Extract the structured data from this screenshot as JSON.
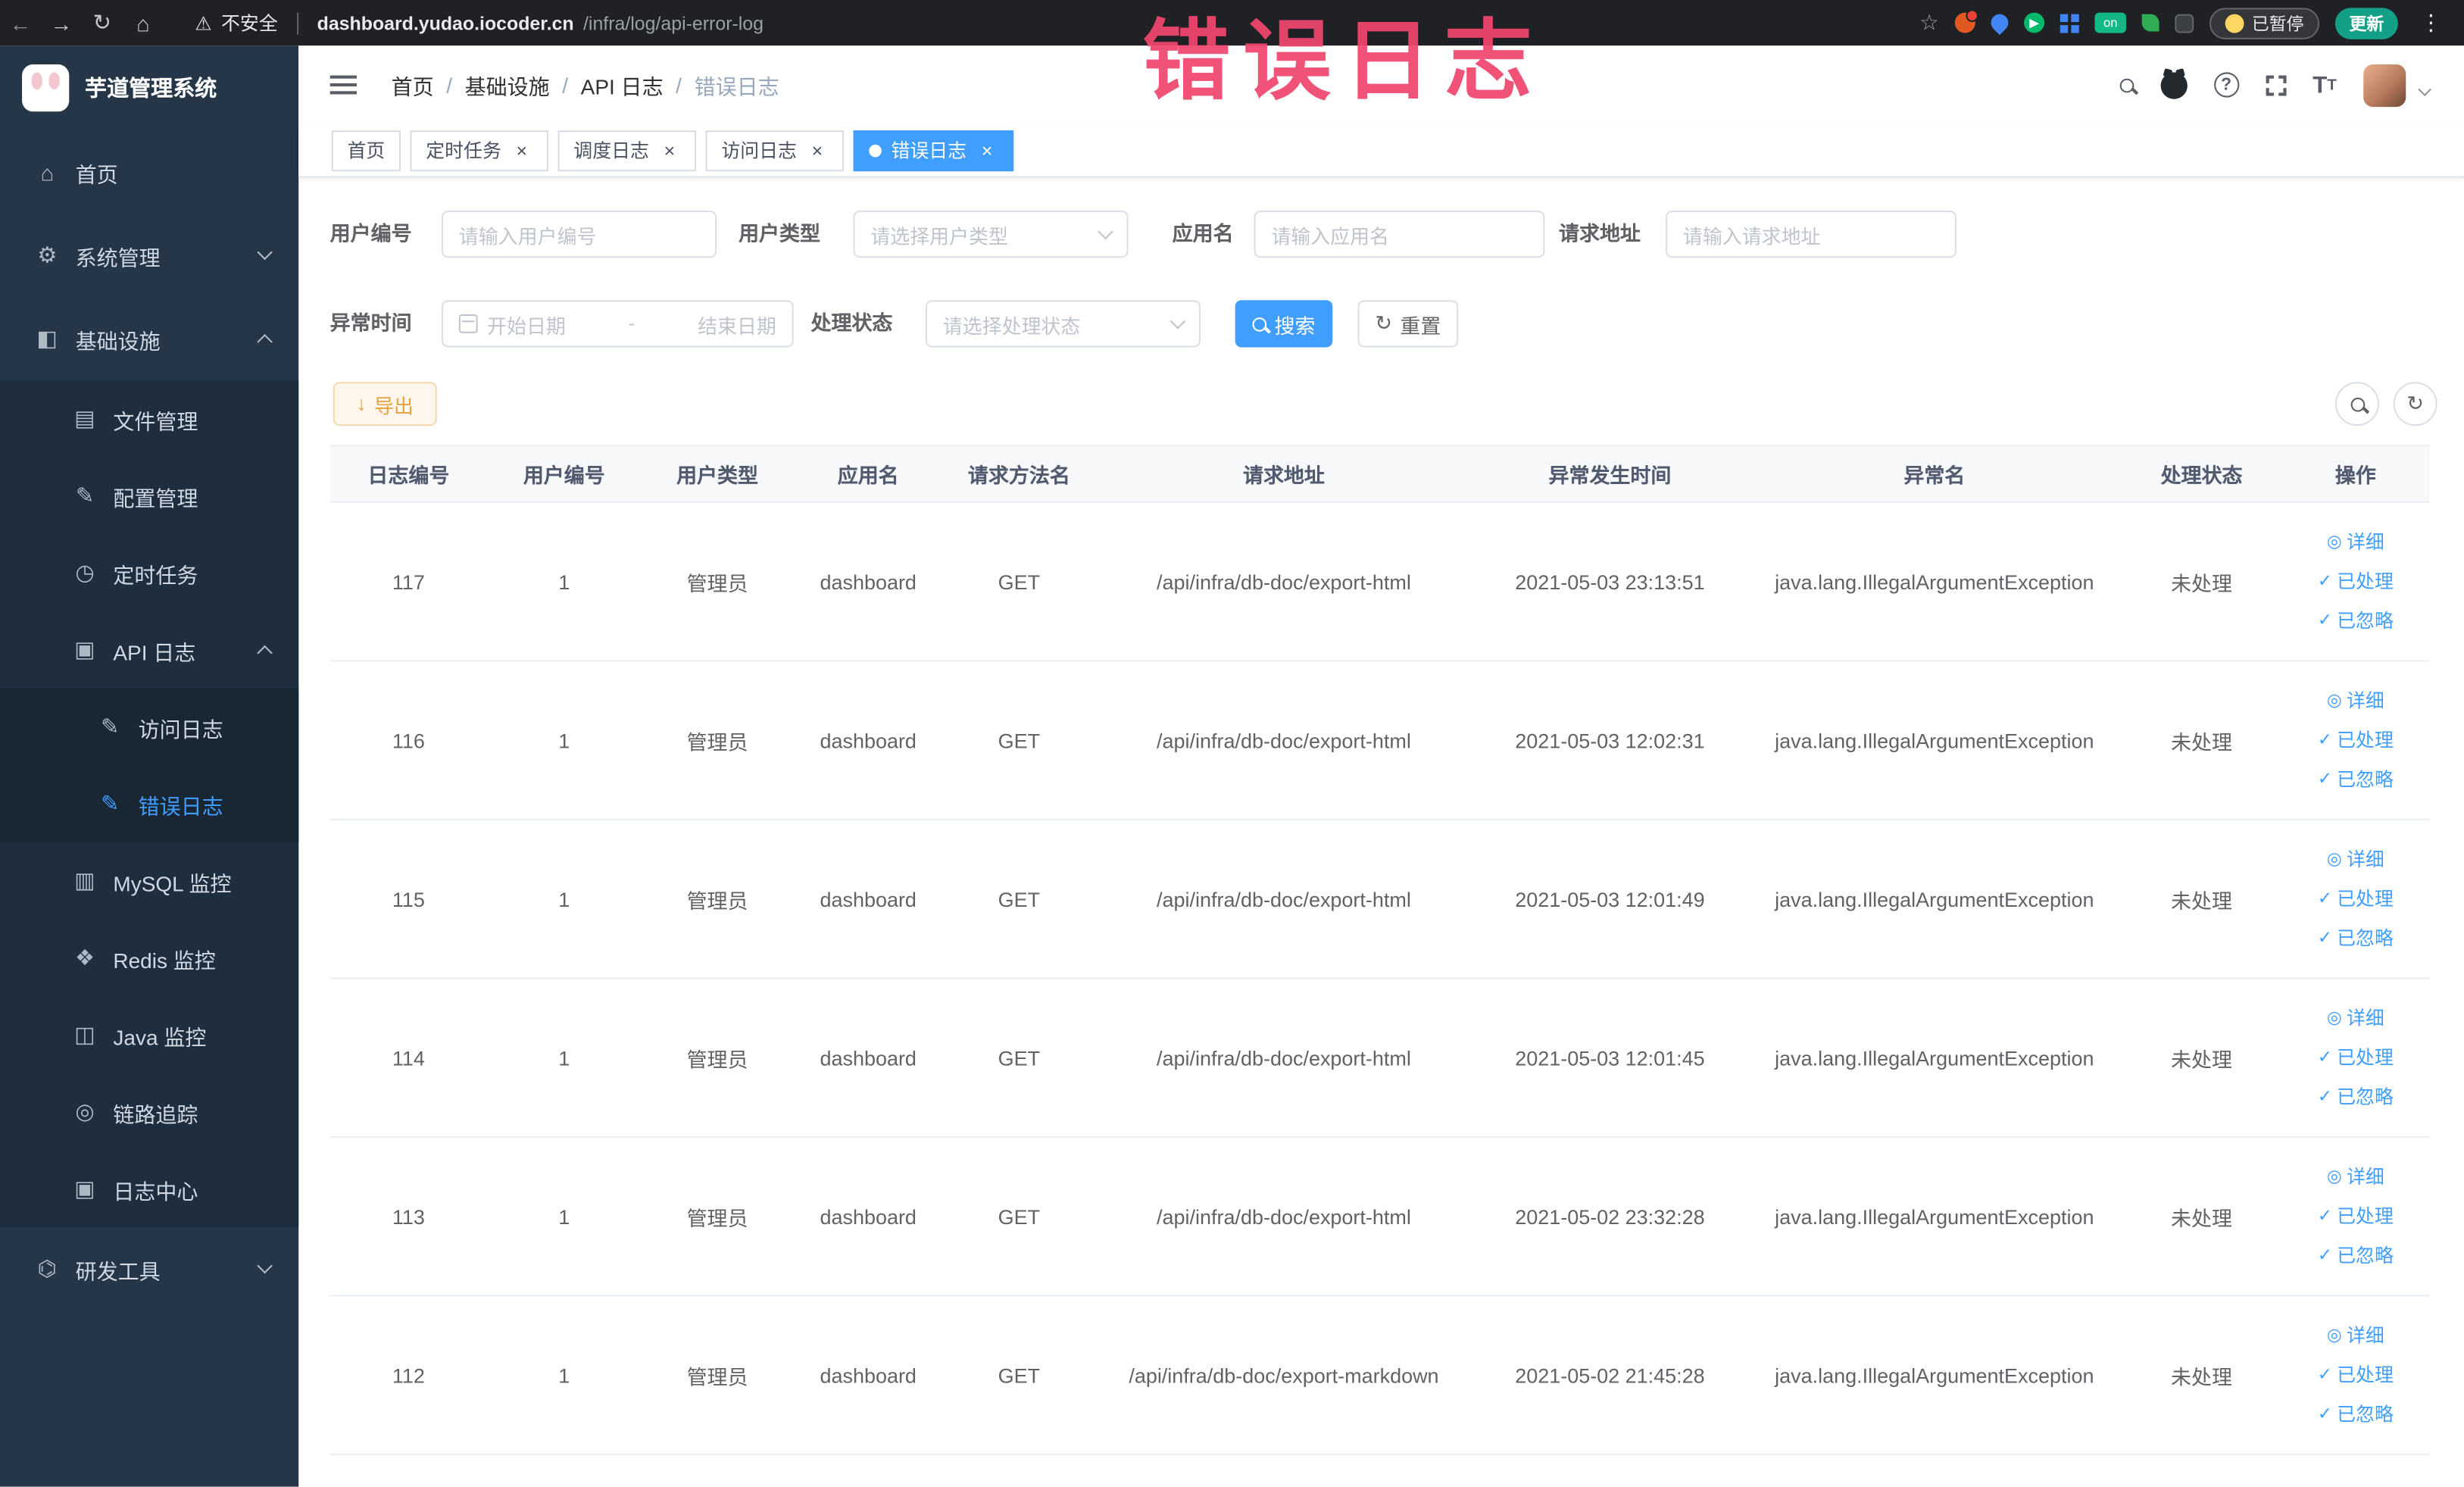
{
  "colors": {
    "accent_blue": "#409eff",
    "annotation_pink": "#f1466e",
    "warning_orange": "#e6a23c",
    "sidebar_bg": "#253649",
    "chrome_bg": "#202124"
  },
  "annotation": {
    "text": "错误日志"
  },
  "browser": {
    "security_label": "不安全",
    "url_host": "dashboard.yudao.iocoder.cn",
    "url_path": "/infra/log/api-error-log",
    "paused_label": "已暂停",
    "update_label": "更新",
    "extension_on_badge": "on"
  },
  "sidebar": {
    "logo_title": "芋道管理系统",
    "menu": {
      "home": "首页",
      "system": "系统管理",
      "infra": "基础设施",
      "file": "文件管理",
      "config": "配置管理",
      "job": "定时任务",
      "api_log": "API 日志",
      "access_log": "访问日志",
      "error_log": "错误日志",
      "mysql": "MySQL 监控",
      "redis": "Redis 监控",
      "java": "Java 监控",
      "trace": "链路追踪",
      "log_center": "日志中心",
      "dev_tools": "研发工具"
    }
  },
  "navbar": {
    "breadcrumb": [
      "首页",
      "基础设施",
      "API 日志",
      "错误日志"
    ]
  },
  "tags": [
    {
      "label": "首页"
    },
    {
      "label": "定时任务"
    },
    {
      "label": "调度日志"
    },
    {
      "label": "访问日志"
    },
    {
      "label": "错误日志"
    }
  ],
  "filters": {
    "user_id_label": "用户编号",
    "user_id_placeholder": "请输入用户编号",
    "user_type_label": "用户类型",
    "user_type_placeholder": "请选择用户类型",
    "app_name_label": "应用名",
    "app_name_placeholder": "请输入应用名",
    "request_url_label": "请求地址",
    "request_url_placeholder": "请输入请求地址",
    "exception_time_label": "异常时间",
    "start_date_placeholder": "开始日期",
    "range_separator": "-",
    "end_date_placeholder": "结束日期",
    "process_status_label": "处理状态",
    "process_status_placeholder": "请选择处理状态",
    "search_label": "搜索",
    "reset_label": "重置"
  },
  "toolbar": {
    "export_label": "导出"
  },
  "table": {
    "headers": [
      "日志编号",
      "用户编号",
      "用户类型",
      "应用名",
      "请求方法名",
      "请求地址",
      "异常发生时间",
      "异常名",
      "处理状态",
      "操作"
    ],
    "action_labels": {
      "detail": "详细",
      "processed": "已处理",
      "ignored": "已忽略"
    },
    "rows": [
      {
        "id": "117",
        "user_id": "1",
        "user_type": "管理员",
        "app": "dashboard",
        "method": "GET",
        "url": "/api/infra/db-doc/export-html",
        "time": "2021-05-03 23:13:51",
        "exception": "java.lang.IllegalArgumentException",
        "status": "未处理"
      },
      {
        "id": "116",
        "user_id": "1",
        "user_type": "管理员",
        "app": "dashboard",
        "method": "GET",
        "url": "/api/infra/db-doc/export-html",
        "time": "2021-05-03 12:02:31",
        "exception": "java.lang.IllegalArgumentException",
        "status": "未处理"
      },
      {
        "id": "115",
        "user_id": "1",
        "user_type": "管理员",
        "app": "dashboard",
        "method": "GET",
        "url": "/api/infra/db-doc/export-html",
        "time": "2021-05-03 12:01:49",
        "exception": "java.lang.IllegalArgumentException",
        "status": "未处理"
      },
      {
        "id": "114",
        "user_id": "1",
        "user_type": "管理员",
        "app": "dashboard",
        "method": "GET",
        "url": "/api/infra/db-doc/export-html",
        "time": "2021-05-03 12:01:45",
        "exception": "java.lang.IllegalArgumentException",
        "status": "未处理"
      },
      {
        "id": "113",
        "user_id": "1",
        "user_type": "管理员",
        "app": "dashboard",
        "method": "GET",
        "url": "/api/infra/db-doc/export-html",
        "time": "2021-05-02 23:32:28",
        "exception": "java.lang.IllegalArgumentException",
        "status": "未处理"
      },
      {
        "id": "112",
        "user_id": "1",
        "user_type": "管理员",
        "app": "dashboard",
        "method": "GET",
        "url": "/api/infra/db-doc/export-markdown",
        "time": "2021-05-02 21:45:28",
        "exception": "java.lang.IllegalArgumentException",
        "status": "未处理"
      }
    ]
  }
}
